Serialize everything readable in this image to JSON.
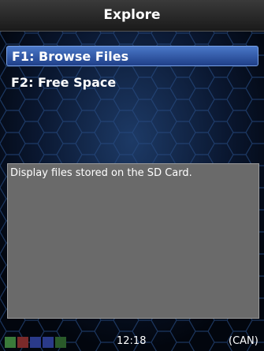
{
  "title": "Explore",
  "menu": {
    "items": [
      {
        "label": "F1: Browse Files",
        "selected": true
      },
      {
        "label": "F2: Free Space",
        "selected": false
      }
    ]
  },
  "description": "Display files stored on the SD Card.",
  "status": {
    "time": "12:18",
    "mode": "(CAN)",
    "indicator_colors": [
      "#3a7a3a",
      "#7a2a2a",
      "#2a3a8a",
      "#2a3a8a",
      "#2a5a2a"
    ]
  },
  "colors": {
    "accent": "#3a64b4",
    "panel": "#6a6a6a"
  }
}
